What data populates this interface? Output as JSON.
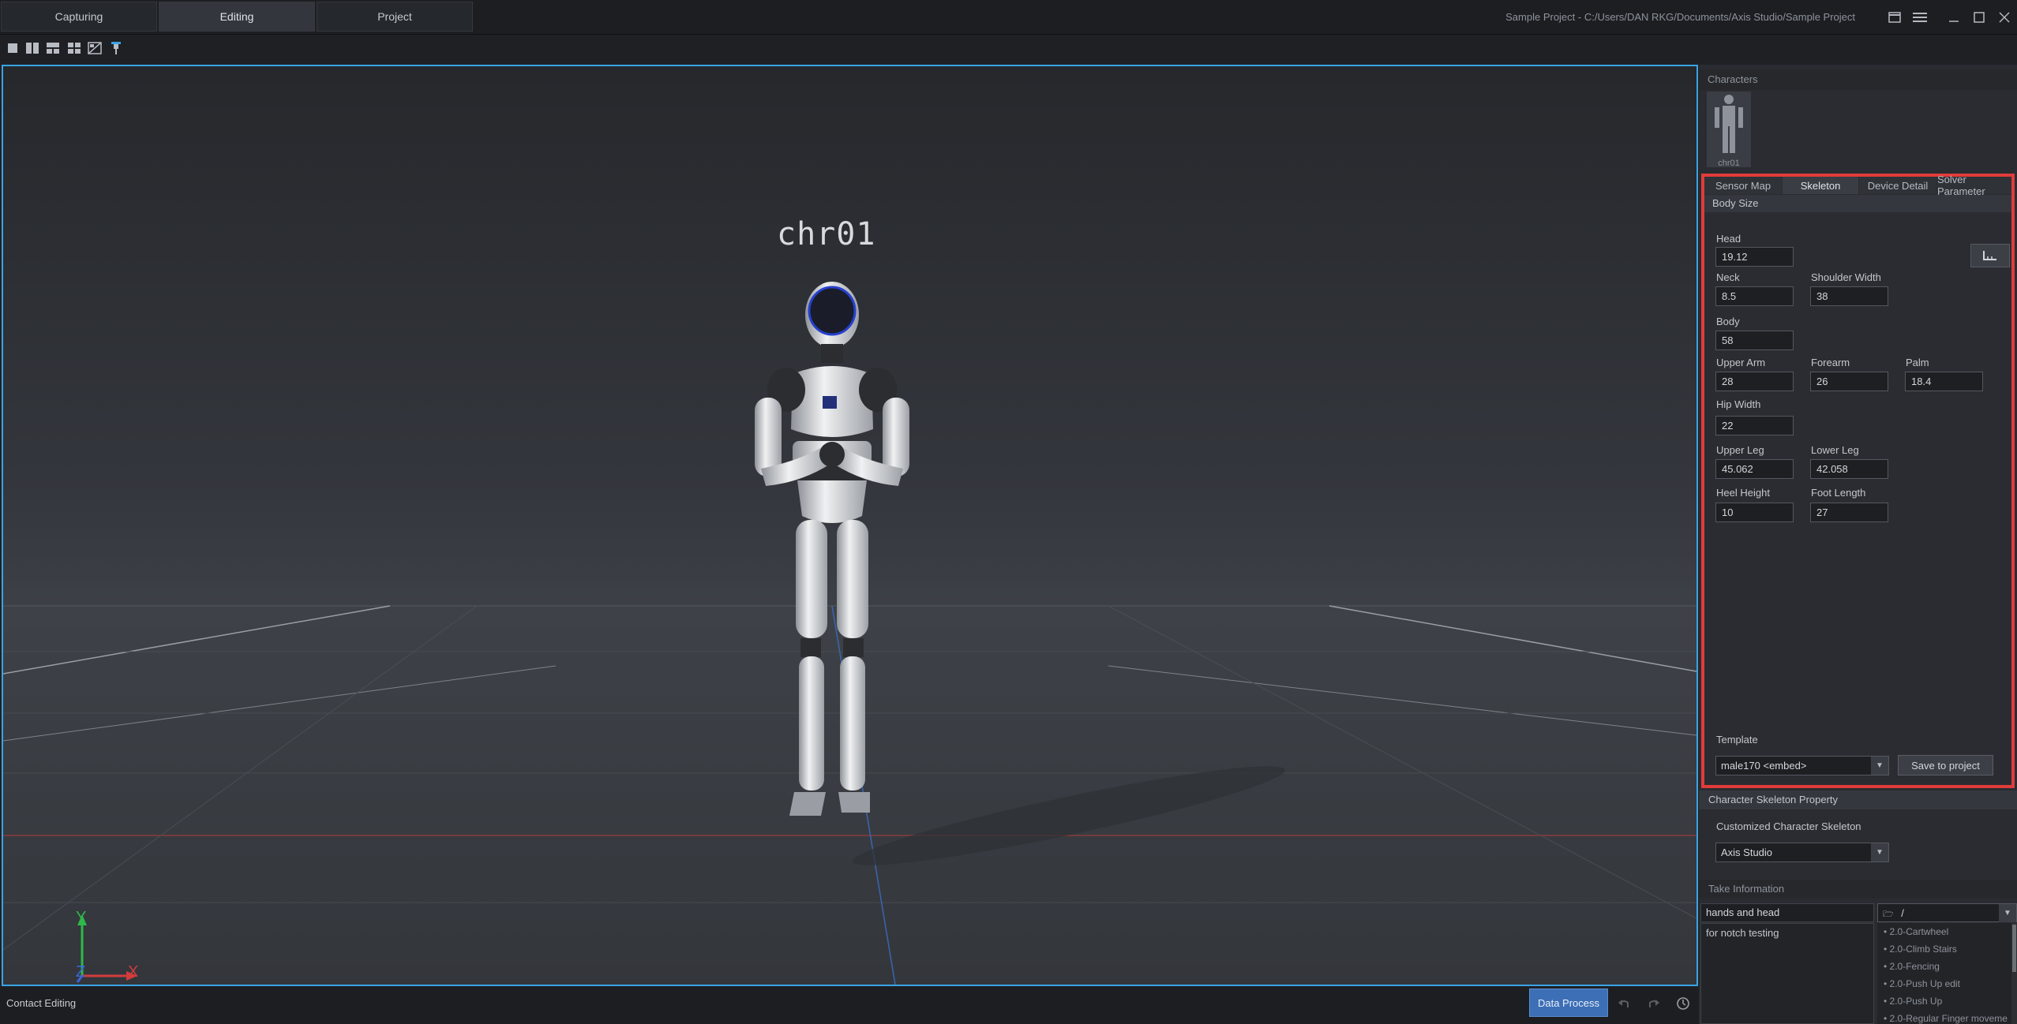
{
  "top_tabs": [
    {
      "label": "Capturing"
    },
    {
      "label": "Editing"
    },
    {
      "label": "Project"
    }
  ],
  "window_title": "Sample Project - C:/Users/DAN RKG/Documents/Axis Studio/Sample Project",
  "toolbar": {
    "icons": [
      "single-view-icon",
      "two-view-icon",
      "three-view-icon",
      "four-view-icon",
      "custom-layout-icon",
      "pin-icon"
    ]
  },
  "viewport": {
    "character_label": "chr01",
    "axis_labels": {
      "x": "X",
      "y": "Y",
      "z": "Z"
    }
  },
  "status_bar": {
    "mode_label": "Contact Editing",
    "data_process_label": "Data Process",
    "icons": [
      "undo-icon",
      "redo-icon",
      "history-icon"
    ]
  },
  "right_panel": {
    "characters_title": "Characters",
    "character_name": "chr01",
    "tabs": [
      {
        "label": "Sensor Map"
      },
      {
        "label": "Skeleton"
      },
      {
        "label": "Device Detail"
      },
      {
        "label": "Solver Parameter"
      }
    ],
    "body_size_title": "Body Size",
    "fields": {
      "head": {
        "label": "Head",
        "value": "19.12"
      },
      "neck": {
        "label": "Neck",
        "value": "8.5"
      },
      "shoulder_width": {
        "label": "Shoulder Width",
        "value": "38"
      },
      "body": {
        "label": "Body",
        "value": "58"
      },
      "upper_arm": {
        "label": "Upper Arm",
        "value": "28"
      },
      "forearm": {
        "label": "Forearm",
        "value": "26"
      },
      "palm": {
        "label": "Palm",
        "value": "18.4"
      },
      "hip_width": {
        "label": "Hip Width",
        "value": "22"
      },
      "upper_leg": {
        "label": "Upper Leg",
        "value": "45.062"
      },
      "lower_leg": {
        "label": "Lower Leg",
        "value": "42.058"
      },
      "heel_height": {
        "label": "Heel Height",
        "value": "10"
      },
      "foot_length": {
        "label": "Foot Length",
        "value": "27"
      }
    },
    "template_label": "Template",
    "template_value": "male170 <embed>",
    "save_button": "Save to project",
    "csp_title": "Character Skeleton Property",
    "custom_skeleton_label": "Customized Character Skeleton",
    "custom_skeleton_value": "Axis Studio",
    "take_title": "Take Information",
    "take_name": "hands and head",
    "take_notes": "for notch testing",
    "folder_value": "/",
    "take_list": [
      "2.0-Cartwheel",
      "2.0-Climb Stairs",
      "2.0-Fencing",
      "2.0-Push Up edit",
      "2.0-Push Up",
      "2.0-Regular Finger moveme"
    ]
  },
  "colors": {
    "accent_blue": "#3aa3e3",
    "highlight_red": "#e23b3b",
    "button_blue": "#3d6fb6"
  }
}
